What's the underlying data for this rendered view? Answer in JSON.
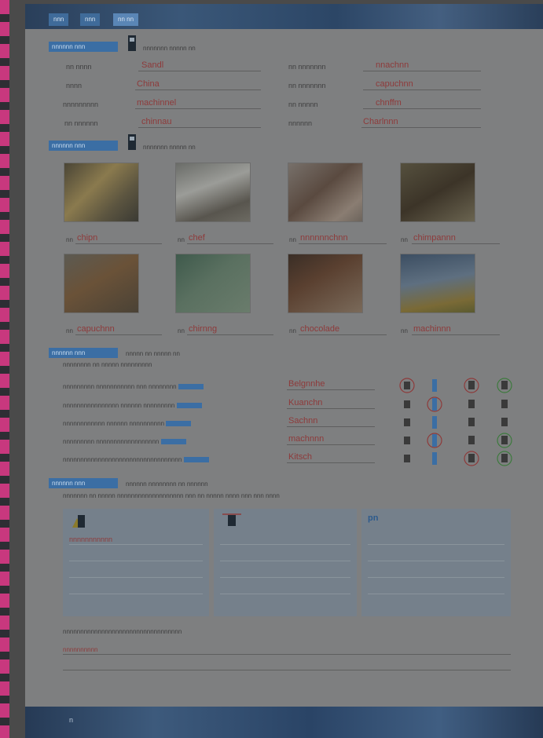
{
  "header": {
    "tabs": [
      "nnn",
      "nnn",
      "nn nn"
    ]
  },
  "exercises": [
    {
      "label": "nnnnnn nnn",
      "instruction": "nnnnnnn nnnnn nn"
    },
    {
      "label": "nnnnnn nnn",
      "instruction": "nnnnnnn nnnnn nn"
    },
    {
      "label": "nnnnnn nnn",
      "instruction": "nnnnn nn nnnnn nn",
      "instruction2": "nnnnnnnn nn nnnnn nnnnnnnnn"
    },
    {
      "label": "nnnnnn nnn",
      "instruction": "nnnnnn nnnnnnnn nn nnnnnn",
      "instruction2": "nnnnnnn nn nnnnn nnnnnnnnnnnnnnnnnnn nnn nn nnnnn nnnn nnn nnn nnnn"
    }
  ],
  "ex1": {
    "left": [
      {
        "word": "nn nnnn",
        "answer": "Sandl"
      },
      {
        "word": "nnnn",
        "answer": "China"
      },
      {
        "word": "nnnnnnnnn",
        "answer": "machinnel"
      },
      {
        "word": "nn nnnnnn",
        "answer": "chinnau"
      }
    ],
    "right": [
      {
        "word": "nn nnnnnnn",
        "answer": "nnachnn"
      },
      {
        "word": "nn nnnnnnn",
        "answer": "capuchnn"
      },
      {
        "word": "nn nnnnn",
        "answer": "chnffm"
      },
      {
        "word": "nnnnnn",
        "answer": "Charlnnn"
      }
    ]
  },
  "ex2": {
    "row1": [
      {
        "art": "nn",
        "answer": "chipn"
      },
      {
        "art": "nn",
        "answer": "chef"
      },
      {
        "art": "nn",
        "answer": "nnnnnnchnn"
      },
      {
        "art": "nn",
        "answer": "chimpannn"
      }
    ],
    "row2": [
      {
        "art": "nn",
        "answer": "capuchnn"
      },
      {
        "art": "nn",
        "answer": "chirnng"
      },
      {
        "art": "nn",
        "answer": "chocolade"
      },
      {
        "art": "nn",
        "answer": "machinnn"
      }
    ]
  },
  "ex3": {
    "sentences": [
      "nnnnnnnnn nnnnnnnnnnn nnn nnnnnnnn",
      "nnnnnnnnnnnnnnnn nnnnnn nnnnnnnnn",
      "nnnnnnnnnnnn nnnnnn nnnnnnnnnn",
      "nnnnnnnnn nnnnnnnnnnnnnnnnnn",
      "nnnnnnnnnnnnnnnnnnnnnnnnnnnnnnnnnn"
    ],
    "answers": [
      "Belgnnhe",
      "Kuanchn",
      "Sachnn",
      "machnnn",
      "Kitsch"
    ]
  },
  "ex4": {
    "columns": [
      "",
      "",
      "pn"
    ],
    "first_entry": "nnnnnnnnnnn",
    "footer_instruction": "nnnnnnnnnnnnnnnnnnnnnnnnnnnnnnnnnn",
    "footer_entry": "nnnnnnnnnn"
  },
  "footer": {
    "page_number": "n"
  }
}
